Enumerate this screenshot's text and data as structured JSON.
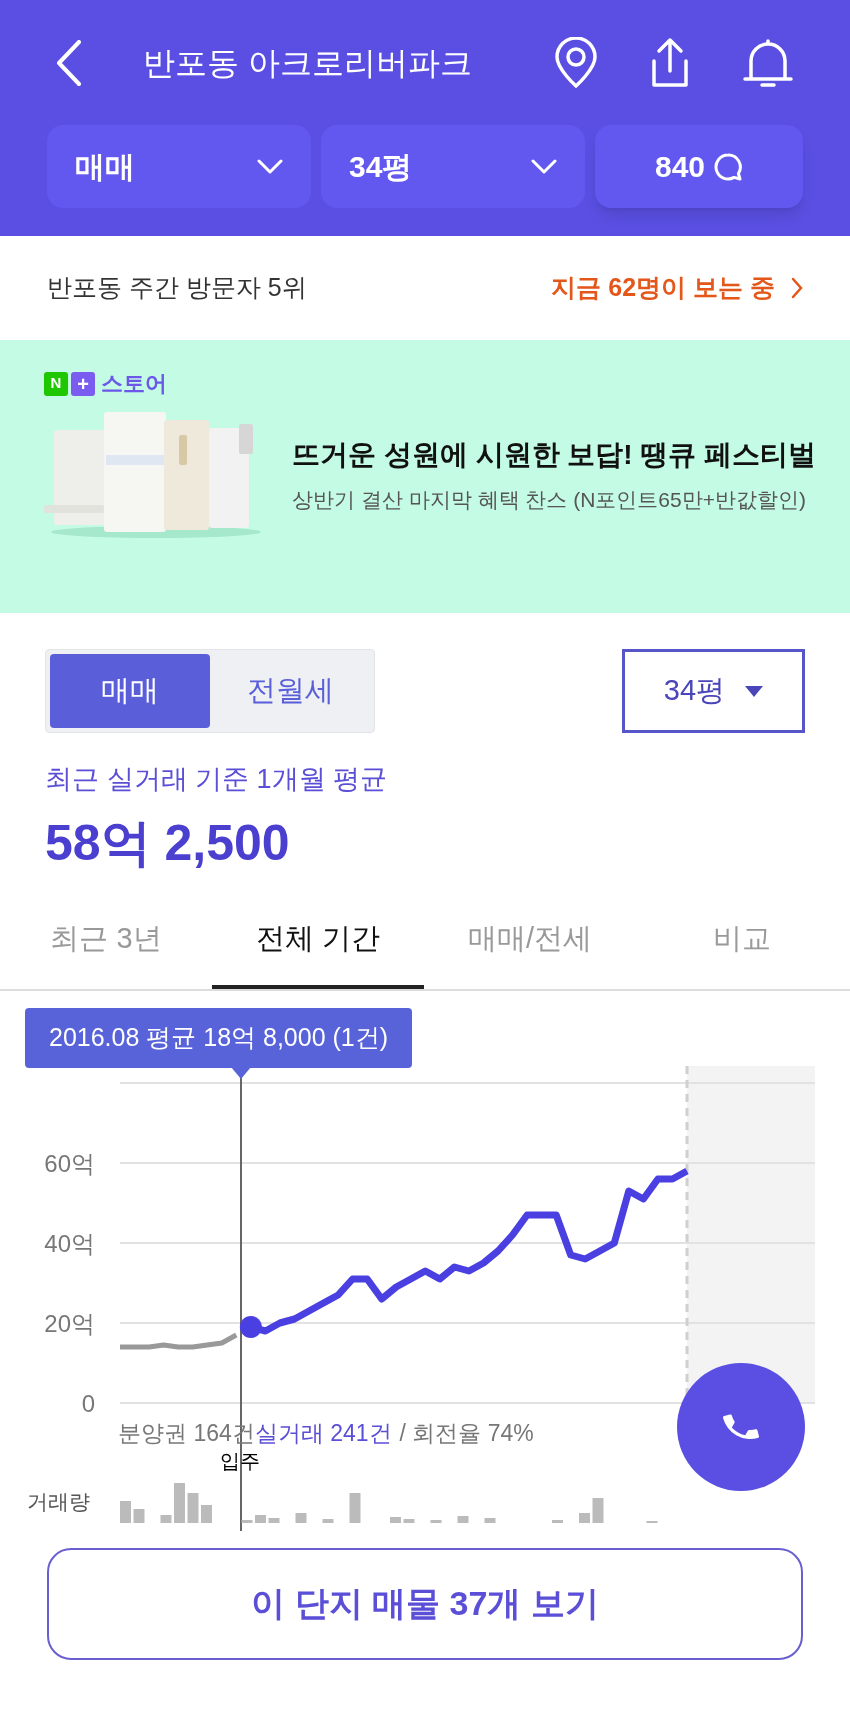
{
  "header": {
    "title": "반포동 아크로리버파크"
  },
  "filters": [
    {
      "kind": "dropdown",
      "label": "매매"
    },
    {
      "kind": "dropdown",
      "label": "34평"
    },
    {
      "kind": "comments",
      "label": "840"
    }
  ],
  "visitor_bar": {
    "rank": "반포동 주간 방문자 5위",
    "live": "지금 62명이 보는 중"
  },
  "ad": {
    "brand_mark": "N",
    "brand_plus": "+",
    "brand": "스토어",
    "headline": "뜨거운 성원에 시원한 보답! 땡큐 페스티벌",
    "subline": "상반기 결산 마지막 혜택 찬스 (N포인트65만+반값할인)"
  },
  "trade_types": [
    {
      "label": "매매",
      "selected": true
    },
    {
      "label": "전월세",
      "selected": false
    }
  ],
  "size_select": {
    "value": "34평"
  },
  "summary": {
    "caption": "최근 실거래 기준 1개월 평균",
    "price": "58억 2,500"
  },
  "tabs": [
    {
      "label": "최근 3년",
      "selected": false
    },
    {
      "label": "전체 기간",
      "selected": true
    },
    {
      "label": "매매/전세",
      "selected": false
    },
    {
      "label": "비교",
      "selected": false
    }
  ],
  "chart": {
    "tooltip": "2016.08 평균 18억 8,000 (1건)",
    "chart_data": {
      "type": "line",
      "grid": true,
      "ylim": [
        0,
        80
      ],
      "yticks": [
        {
          "value": 0,
          "label": "0"
        },
        {
          "value": 20,
          "label": "20억"
        },
        {
          "value": 40,
          "label": "40억"
        },
        {
          "value": 60,
          "label": "60억"
        }
      ],
      "series": [
        {
          "color": "#999999",
          "values": [
            14,
            14,
            14,
            14.5,
            14,
            14,
            14.5,
            15,
            17,
            null,
            null,
            null,
            null,
            null,
            null,
            null,
            null,
            null,
            null,
            null,
            null,
            null,
            null,
            null,
            null,
            null,
            null,
            null,
            null,
            null,
            null,
            null,
            null,
            null,
            null,
            null,
            null,
            null,
            null,
            null
          ]
        },
        {
          "color": "#4a3fe0",
          "values": [
            null,
            null,
            null,
            null,
            null,
            null,
            null,
            null,
            null,
            19,
            18,
            20,
            21,
            23,
            25,
            27,
            31,
            31,
            26,
            29,
            31,
            33,
            31,
            34,
            33,
            35,
            38,
            42,
            47,
            47,
            47,
            37,
            36,
            38,
            40,
            53,
            51,
            56,
            56,
            58
          ]
        }
      ]
    },
    "presale": "분양권 164건",
    "trades": "실거래 241건",
    "turnover": "/ 회전율 74%",
    "event": "입주",
    "volume_label": "거래량"
  },
  "cta": {
    "label": "이 단지 매물 37개 보기"
  }
}
